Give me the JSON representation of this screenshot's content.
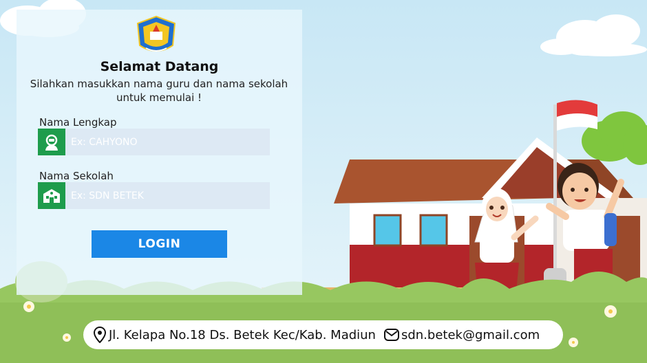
{
  "header": {
    "title": "Selamat Datang",
    "subtitle_line1": "Silahkan masukkan nama guru dan nama sekolah",
    "subtitle_line2": "untuk memulai !"
  },
  "form": {
    "name_label": "Nama Lengkap",
    "name_placeholder": "Ex: CAHYONO",
    "name_icon": "teacher-avatar-icon",
    "school_label": "Nama Sekolah",
    "school_placeholder": "Ex: SDN BETEK",
    "school_icon": "school-building-icon",
    "login_label": "LOGIN"
  },
  "footer": {
    "address_icon": "location-pin-icon",
    "address": "Jl. Kelapa No.18 Ds. Betek Kec/Kab. Madiun",
    "email_icon": "envelope-icon",
    "email": "sdn.betek@gmail.com"
  },
  "colors": {
    "accent_green": "#1e9c4c",
    "login_blue": "#1b87e6",
    "input_bg": "#dde9f4"
  }
}
